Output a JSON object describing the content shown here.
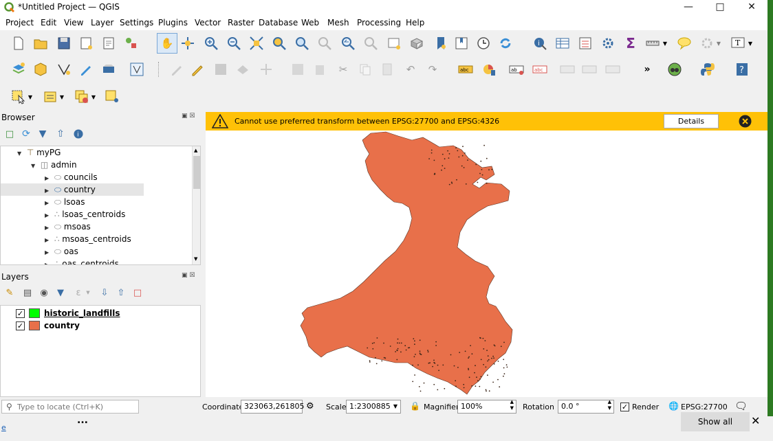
{
  "window": {
    "title": "*Untitled Project — QGIS"
  },
  "menu": [
    "Project",
    "Edit",
    "View",
    "Layer",
    "Settings",
    "Plugins",
    "Vector",
    "Raster",
    "Database",
    "Web",
    "Mesh",
    "Processing",
    "Help"
  ],
  "browser": {
    "title": "Browser",
    "items": {
      "myPG": "myPG",
      "admin": "admin",
      "councils": "councils",
      "country": "country",
      "lsoas": "lsoas",
      "lsoas_centroids": "lsoas_centroids",
      "msoas": "msoas",
      "msoas_centroids": "msoas_centroids",
      "oas": "oas",
      "oas_centroids": "oas_centroids"
    }
  },
  "layers": {
    "title": "Layers",
    "items": [
      {
        "name": "historic_landfills",
        "color": "#00ff00",
        "checked": true,
        "bold": true,
        "underline": true
      },
      {
        "name": "country",
        "color": "#e8704a",
        "checked": true,
        "bold": true,
        "underline": false
      }
    ]
  },
  "message": {
    "text": "Cannot use preferred transform between EPSG:27700 and EPSG:4326",
    "details": "Details"
  },
  "map": {
    "fill": "#e8704a"
  },
  "status": {
    "locate_placeholder": "Type to locate (Ctrl+K)",
    "coordinate_label": "Coordinate",
    "coordinate": "323063,261805",
    "scale_label": "Scale",
    "scale": "1:2300885",
    "magnifier_label": "Magnifier",
    "magnifier": "100%",
    "rotation_label": "Rotation",
    "rotation": "0.0 °",
    "render_label": "Render",
    "crs": "EPSG:27700"
  },
  "taskbar": {
    "show_all": "Show all",
    "more": "...",
    "left_glyph": "e"
  }
}
